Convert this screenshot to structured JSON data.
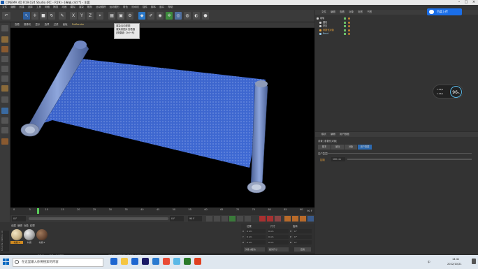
{
  "window": {
    "title": "CINEMA 4D R19.024 Studio (RC - R19) - [卷轴.c4d *] - 主要"
  },
  "menubar": [
    "文件",
    "编辑",
    "创建",
    "选择",
    "工具",
    "网格",
    "捕捉",
    "动画",
    "模拟",
    "渲染",
    "雕刻",
    "运动跟踪",
    "运动图形",
    "角色",
    "流水线",
    "插件",
    "脚本",
    "窗口",
    "帮助"
  ],
  "toolbar": {
    "axis_labels": [
      "X",
      "Y",
      "Z"
    ]
  },
  "tooltip": {
    "lines": [
      "渲染活动视图",
      "渲染到图片查看器",
      "[快捷键: Ctrl+R]"
    ]
  },
  "viewport": {
    "menu": [
      "查看",
      "摄像机",
      "显示",
      "选项",
      "过滤",
      "面板",
      "ProRender"
    ]
  },
  "timeline": {
    "ticks": [
      "0",
      "5",
      "10",
      "15",
      "20",
      "25",
      "30",
      "35",
      "40",
      "45",
      "50",
      "55",
      "60",
      "65",
      "70",
      "75",
      "80",
      "85",
      "90"
    ],
    "end_frame": "0 F",
    "current_frame": "0 F",
    "max_frame": "90 F",
    "scale_label": "90 F"
  },
  "material_manager": {
    "menu": [
      "创建",
      "编辑",
      "功能",
      "纹理"
    ],
    "materials": [
      {
        "name": "材质.1",
        "color": "#c9b48a"
      },
      {
        "name": "材质",
        "color": "#a9a9a9"
      },
      {
        "name": "材质.2",
        "color": "#6b4a36"
      }
    ]
  },
  "coordinates": {
    "headers": [
      "位置",
      "尺寸",
      "旋转"
    ],
    "rows": [
      {
        "axis": "X",
        "pos": "0 cm",
        "size": "0 cm",
        "rot_label": "H",
        "rot": "0 °"
      },
      {
        "axis": "Y",
        "pos": "0 cm",
        "size": "0 cm",
        "rot_label": "P",
        "rot": "0 °"
      },
      {
        "axis": "Z",
        "pos": "0 cm",
        "size": "0 cm",
        "rot_label": "B",
        "rot": "0 °"
      }
    ],
    "mode_dropdown": "对象 (相对)",
    "size_dropdown": "绝对尺寸",
    "apply_button": "应用"
  },
  "object_manager": {
    "menu": [
      "文件",
      "编辑",
      "查看",
      "对象",
      "标签",
      "书签"
    ],
    "objects": [
      {
        "name": "卷轴",
        "color": "#d0d0d0"
      },
      {
        "name": "圆柱",
        "color": "#d0d0d0"
      },
      {
        "name": "挤压",
        "color": "#d0d0d0"
      },
      {
        "name": "参数化对象",
        "color": "#e8a23a"
      },
      {
        "name": "Bend",
        "color": "#9ad0f0"
      }
    ]
  },
  "attribute_manager": {
    "tabs_top": [
      "模式",
      "编辑",
      "用户数据"
    ],
    "object_label": "对象 [参数化对象]",
    "sub_tabs": [
      "基本",
      "坐标",
      "对象",
      "用户数据"
    ],
    "section": "用户数据",
    "field_label": "控制",
    "field_value": "100 cm"
  },
  "status": {
    "text": "00:00:12 [渲染帧] 0/1 渲染 - 光线跟踪 [0/1] [0:00]",
    "hint": "渲染活动视图到图片查看器 [快捷键 Ctrl+R]"
  },
  "cloud_button": {
    "label": "百度上传"
  },
  "fps_badge": {
    "value": "96",
    "unit": "%",
    "line1": "1.9K/s",
    "line2": "1.9K/s"
  },
  "taskbar": {
    "search_placeholder": "在这里输入你要搜索的内容",
    "time": "14:41",
    "date": "2022/10/21",
    "lang": "中",
    "icon_colors": [
      "#1e66d0",
      "#f5c542",
      "#1e66d0",
      "#1a1a66",
      "#2a7ad0",
      "#e94b35",
      "#5ab8e6",
      "#2a7a2a",
      "#e04020"
    ]
  }
}
